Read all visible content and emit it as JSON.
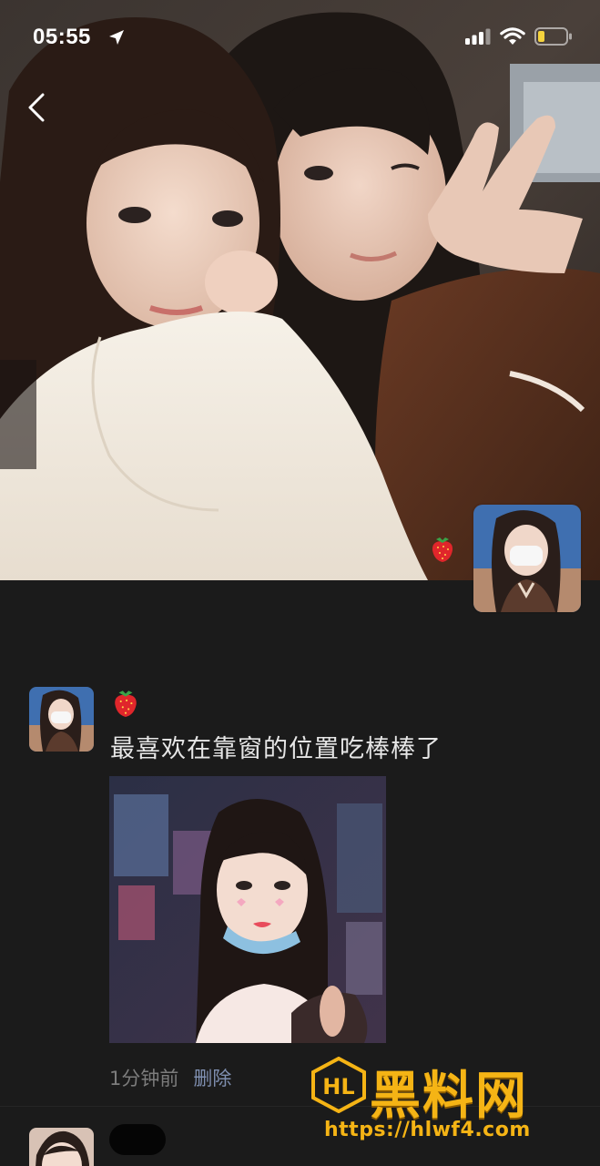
{
  "status_bar": {
    "time": "05:55",
    "icons": [
      "location-arrow-icon",
      "cellular-signal-icon",
      "wifi-icon",
      "battery-icon"
    ]
  },
  "navigation": {
    "back_icon": "chevron-left-icon"
  },
  "cover": {
    "emoji": "strawberry"
  },
  "post": {
    "emoji": "strawberry",
    "text": "最喜欢在靠窗的位置吃棒棒了",
    "time": "1分钟前",
    "delete_label": "删除"
  },
  "watermark": {
    "title": "黑料网",
    "url": "https://hlwf4.com",
    "logo_text": "HL"
  },
  "colors": {
    "background": "#1b1b1b",
    "post_text": "#e6e6e6",
    "meta_gray": "#7c7c7c",
    "link_blue": "#7f8fb0",
    "watermark_gold": "#f5b415"
  }
}
